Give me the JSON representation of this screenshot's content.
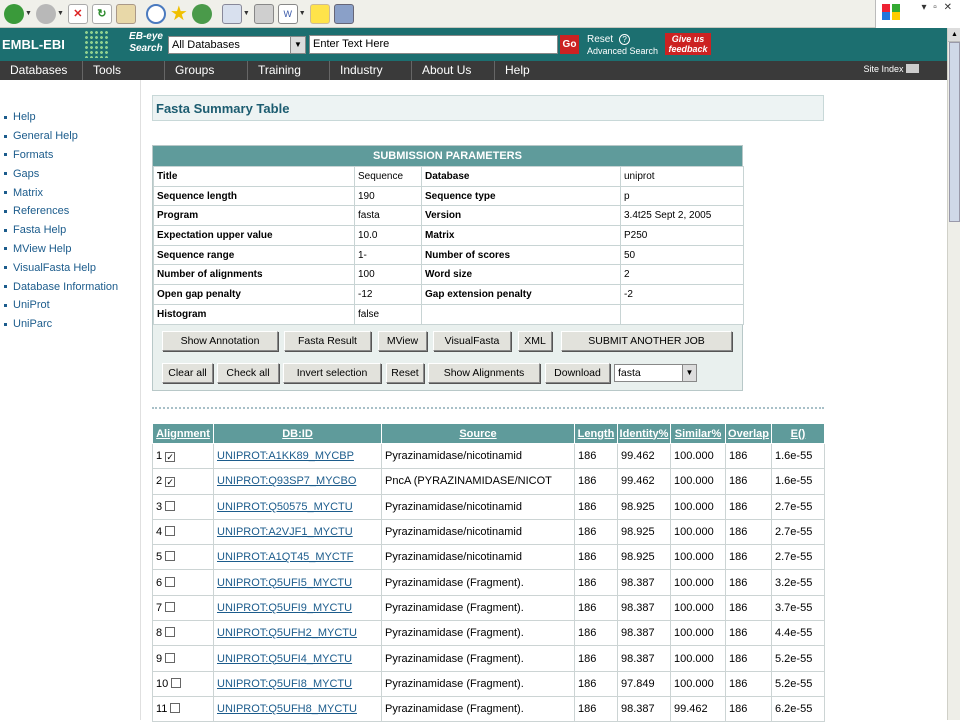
{
  "toolbar": {
    "icons": [
      "back-icon",
      "forward-icon",
      "stop-icon",
      "refresh-icon",
      "home-icon",
      "search-icon",
      "favorites-icon",
      "history-icon",
      "mail-icon",
      "print-icon",
      "edit-icon",
      "note-icon",
      "research-icon"
    ]
  },
  "header": {
    "logo": "EMBL-EBI",
    "ebeye": "EB-eye Search",
    "db_select": "All Databases",
    "search_placeholder": "Enter Text Here",
    "go": "Go",
    "reset": "Reset",
    "help_q": "?",
    "advanced": "Advanced Search",
    "feedback": "Give us feedback"
  },
  "nav": {
    "items": [
      "Databases",
      "Tools",
      "Groups",
      "Training",
      "Industry",
      "About Us",
      "Help"
    ],
    "site_index": "Site Index"
  },
  "sidebar": {
    "items": [
      "Help",
      "General Help",
      "Formats",
      "Gaps",
      "Matrix",
      "References",
      "Fasta Help",
      "MView Help",
      "VisualFasta Help",
      "Database Information",
      "UniProt",
      "UniParc"
    ]
  },
  "page_title": "Fasta Summary Table",
  "submission": {
    "heading": "SUBMISSION PARAMETERS",
    "rows": [
      [
        "Title",
        "Sequence",
        "Database",
        "uniprot"
      ],
      [
        "Sequence length",
        "190",
        "Sequence type",
        "p"
      ],
      [
        "Program",
        "fasta",
        "Version",
        "3.4t25 Sept 2, 2005"
      ],
      [
        "Expectation upper value",
        "10.0",
        "Matrix",
        "P250"
      ],
      [
        "Sequence range",
        "1-",
        "Number of scores",
        "50"
      ],
      [
        "Number of alignments",
        "100",
        "Word size",
        "2"
      ],
      [
        "Open gap penalty",
        "-12",
        "Gap extension penalty",
        "-2"
      ],
      [
        "Histogram",
        "false",
        "",
        ""
      ]
    ]
  },
  "buttons": {
    "show_annotation": "Show Annotation",
    "fasta_result": "Fasta Result",
    "mview": "MView",
    "visualfasta": "VisualFasta",
    "xml": "XML",
    "submit_another": "SUBMIT ANOTHER JOB",
    "clear_all": "Clear all",
    "check_all": "Check all",
    "invert": "Invert selection",
    "reset": "Reset",
    "show_alignments": "Show Alignments",
    "download": "Download",
    "format": "fasta"
  },
  "results": {
    "headers": [
      "Alignment",
      "DB:ID",
      "Source",
      "Length",
      "Identity%",
      "Similar%",
      "Overlap",
      "E()"
    ],
    "rows": [
      {
        "n": "1",
        "checked": true,
        "id": "UNIPROT:A1KK89_MYCBP",
        "src": "Pyrazinamidase/nicotinamid",
        "len": "186",
        "ident": "99.462",
        "sim": "100.000",
        "ovl": "186",
        "e": "1.6e-55"
      },
      {
        "n": "2",
        "checked": true,
        "id": "UNIPROT:Q93SP7_MYCBO",
        "src": "PncA (PYRAZINAMIDASE/NICOT",
        "len": "186",
        "ident": "99.462",
        "sim": "100.000",
        "ovl": "186",
        "e": "1.6e-55"
      },
      {
        "n": "3",
        "checked": false,
        "id": "UNIPROT:Q50575_MYCTU",
        "src": "Pyrazinamidase/nicotinamid",
        "len": "186",
        "ident": "98.925",
        "sim": "100.000",
        "ovl": "186",
        "e": "2.7e-55"
      },
      {
        "n": "4",
        "checked": false,
        "id": "UNIPROT:A2VJF1_MYCTU",
        "src": "Pyrazinamidase/nicotinamid",
        "len": "186",
        "ident": "98.925",
        "sim": "100.000",
        "ovl": "186",
        "e": "2.7e-55"
      },
      {
        "n": "5",
        "checked": false,
        "id": "UNIPROT:A1QT45_MYCTF",
        "src": "Pyrazinamidase/nicotinamid",
        "len": "186",
        "ident": "98.925",
        "sim": "100.000",
        "ovl": "186",
        "e": "2.7e-55"
      },
      {
        "n": "6",
        "checked": false,
        "id": "UNIPROT:Q5UFI5_MYCTU",
        "src": "Pyrazinamidase (Fragment).",
        "len": "186",
        "ident": "98.387",
        "sim": "100.000",
        "ovl": "186",
        "e": "3.2e-55"
      },
      {
        "n": "7",
        "checked": false,
        "id": "UNIPROT:Q5UFI9_MYCTU",
        "src": "Pyrazinamidase (Fragment).",
        "len": "186",
        "ident": "98.387",
        "sim": "100.000",
        "ovl": "186",
        "e": "3.7e-55"
      },
      {
        "n": "8",
        "checked": false,
        "id": "UNIPROT:Q5UFH2_MYCTU",
        "src": "Pyrazinamidase (Fragment).",
        "len": "186",
        "ident": "98.387",
        "sim": "100.000",
        "ovl": "186",
        "e": "4.4e-55"
      },
      {
        "n": "9",
        "checked": false,
        "id": "UNIPROT:Q5UFI4_MYCTU",
        "src": "Pyrazinamidase (Fragment).",
        "len": "186",
        "ident": "98.387",
        "sim": "100.000",
        "ovl": "186",
        "e": "5.2e-55"
      },
      {
        "n": "10",
        "checked": false,
        "id": "UNIPROT:Q5UFI8_MYCTU",
        "src": "Pyrazinamidase (Fragment).",
        "len": "186",
        "ident": "97.849",
        "sim": "100.000",
        "ovl": "186",
        "e": "5.2e-55"
      },
      {
        "n": "11",
        "checked": false,
        "id": "UNIPROT:Q5UFH8_MYCTU",
        "src": "Pyrazinamidase (Fragment).",
        "len": "186",
        "ident": "98.387",
        "sim": "99.462",
        "ovl": "186",
        "e": "6.2e-55"
      }
    ]
  }
}
